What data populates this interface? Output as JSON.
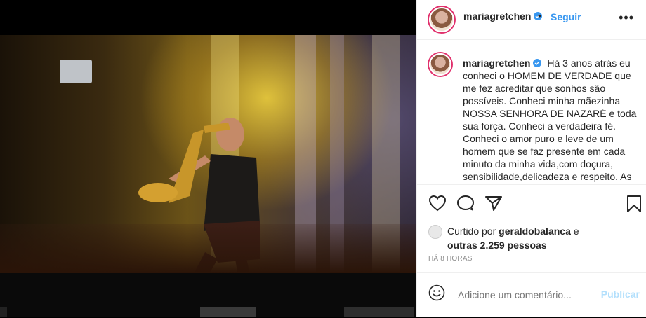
{
  "post": {
    "username": "mariagretchen",
    "follow_label": "Seguir",
    "separator": "•",
    "more_label": "•••",
    "caption": "Há 3 anos atrás eu conheci o HOMEM DE VERDADE que me fez acreditar que sonhos são possíveis. Conheci minha mãezinha NOSSA SENHORA DE NAZARÉ e toda sua força. Conheci a verdadeira fé. Conheci o amor puro e leve de um homem que se faz presente em cada minuto da minha vida,com doçura, sensibilidade,delicadeza e respeito. As",
    "likes_prefix": "Curtido por",
    "liked_by": "geraldobalanca",
    "likes_conjunction": "e",
    "likes_others": "outras 2.259 pessoas",
    "time_ago": "HÁ 8 HORAS",
    "comment_placeholder": "Adicione um comentário...",
    "publish_label": "Publicar"
  },
  "icons": [
    "verified-icon",
    "more-icon",
    "heart-icon",
    "comment-icon",
    "share-icon",
    "bookmark-icon",
    "emoji-icon"
  ],
  "colors": {
    "accent": "#3897f0",
    "publish_disabled": "#b2dffc",
    "text": "#262626",
    "muted": "#8e8e8e",
    "story_ring": "#e1306c"
  }
}
